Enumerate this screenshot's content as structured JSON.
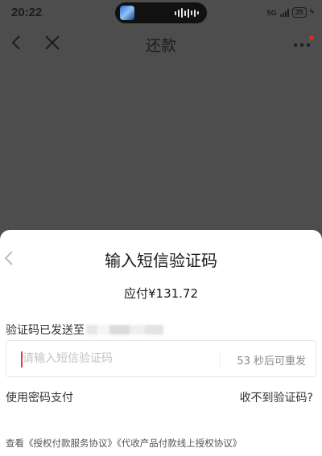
{
  "status_bar": {
    "time": "20:22",
    "network": "5G",
    "battery": "35"
  },
  "nav": {
    "title": "还款"
  },
  "sheet": {
    "title": "输入短信验证码",
    "amount_text": "应付¥131.72",
    "sent_to_text": "验证码已发送至",
    "code_input": {
      "value": "",
      "placeholder": "请输入短信验证码"
    },
    "resend_text": "53 秒后可重发",
    "alt_pay_label": "使用密码支付",
    "no_code_label": "收不到验证码?",
    "agreements": {
      "prefix": "查看",
      "link1": "《授权付款服务协议》",
      "link2": "《代收产品付款线上授权协议》"
    }
  },
  "icons": {
    "nav_back": "chevron-left-icon",
    "nav_close": "close-icon",
    "nav_more": "more-dots-icon",
    "sheet_back": "chevron-left-icon"
  },
  "colors": {
    "accent": "#e53935",
    "badge": "#e0281e"
  }
}
